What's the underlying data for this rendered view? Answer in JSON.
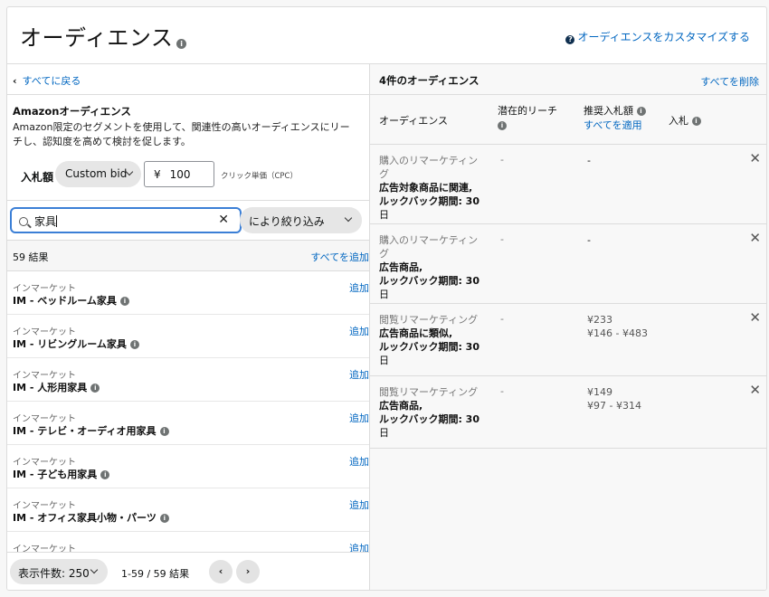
{
  "header": {
    "title": "オーディエンス",
    "customize_link": "オーディエンスをカスタマイズする"
  },
  "left": {
    "back_label": "すべてに戻る",
    "amazon_title": "Amazonオーディエンス",
    "amazon_desc_line1": "Amazon限定のセグメントを使用して、関連性の高いオーディエンスにリー",
    "amazon_desc_line2": "チし、認知度を高めて検討を促します。",
    "bid_label": "入札額",
    "bid_type": "Custom bid",
    "currency": "¥",
    "bid_value": "100",
    "bid_unit": "クリック単価（CPC）",
    "search_value": "家具",
    "filter_label": "により絞り込み",
    "results_count": "59 結果",
    "add_all": "すべてを追加",
    "items": [
      {
        "category": "インマーケット",
        "name": "IM - ベッドルーム家具",
        "add": "追加"
      },
      {
        "category": "インマーケット",
        "name": "IM - リビングルーム家具",
        "add": "追加"
      },
      {
        "category": "インマーケット",
        "name": "IM - 人形用家具",
        "add": "追加"
      },
      {
        "category": "インマーケット",
        "name": "IM - テレビ・オーディオ用家具",
        "add": "追加"
      },
      {
        "category": "インマーケット",
        "name": "IM - 子ども用家具",
        "add": "追加"
      },
      {
        "category": "インマーケット",
        "name": "IM - オフィス家具小物・パーツ",
        "add": "追加"
      },
      {
        "category": "インマーケット",
        "name": "",
        "add": "追加"
      }
    ],
    "footer": {
      "page_size": "表示件数: 250",
      "range": "1-59 / 59 結果"
    }
  },
  "right": {
    "title": "4件のオーディエンス",
    "clear_all": "すべてを削除",
    "columns": {
      "audience": "オーディエンス",
      "reach": "潜在的リーチ",
      "suggested_bid": "推奨入札額",
      "apply_all": "すべてを適用",
      "bid": "入札"
    },
    "rows": [
      {
        "type_l1": "購入のリマーケティン",
        "type_l2": "グ",
        "detail_l1": "広告対象商品に関連,",
        "detail_l2": "ルックバック期間: 30",
        "detail_l3": "日",
        "reach": "-",
        "sugg": "-",
        "sugg_range": ""
      },
      {
        "type_l1": "購入のリマーケティン",
        "type_l2": "グ",
        "detail_l1": "広告商品,",
        "detail_l2": "ルックバック期間: 30",
        "detail_l3": "日",
        "reach": "-",
        "sugg": "-",
        "sugg_range": ""
      },
      {
        "type_l1": "閲覧リマーケティング",
        "type_l2": "",
        "detail_l1": "広告商品に類似,",
        "detail_l2": "ルックバック期間: 30",
        "detail_l3": "日",
        "reach": "-",
        "sugg": "¥233",
        "sugg_range": "¥146 - ¥483"
      },
      {
        "type_l1": "閲覧リマーケティング",
        "type_l2": "",
        "detail_l1": "広告商品,",
        "detail_l2": "ルックバック期間: 30",
        "detail_l3": "日",
        "reach": "-",
        "sugg": "¥149",
        "sugg_range": "¥97 - ¥314"
      }
    ]
  },
  "colors": {
    "link": "#0066c0",
    "focus": "#3b7fd6",
    "pill_bg": "#e6e6e6"
  }
}
